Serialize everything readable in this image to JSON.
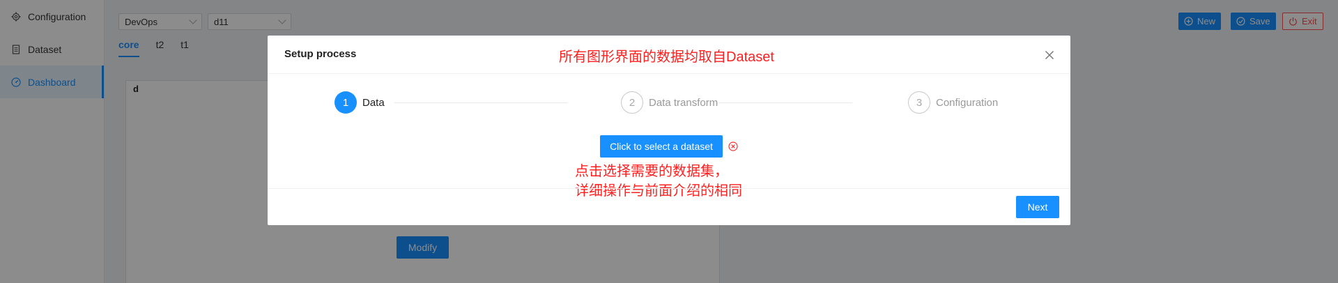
{
  "sidebar": {
    "items": [
      {
        "label": "Configuration",
        "icon": "gear-icon"
      },
      {
        "label": "Dataset",
        "icon": "file-icon"
      },
      {
        "label": "Dashboard",
        "icon": "dashboard-icon",
        "active": true
      }
    ]
  },
  "topbar": {
    "project_select": "DevOps",
    "dashboard_select": "d11",
    "tabs": [
      "core",
      "t2",
      "t1"
    ],
    "active_tab": "core",
    "new_label": "New",
    "save_label": "Save",
    "exit_label": "Exit"
  },
  "panel": {
    "title": "d",
    "modify_label": "Modify"
  },
  "modal": {
    "title": "Setup process",
    "note": "所有图形界面的数据均取自Dataset",
    "steps": [
      {
        "number": "1",
        "label": "Data",
        "status": "active"
      },
      {
        "number": "2",
        "label": "Data transform",
        "status": "wait"
      },
      {
        "number": "3",
        "label": "Configuration",
        "status": "wait"
      }
    ],
    "select_dataset_label": "Click to select a dataset",
    "annotation_line1": "点击选择需要的数据集，",
    "annotation_line2": "详细操作与前面介绍的相同",
    "next_label": "Next"
  },
  "colors": {
    "primary": "#1890ff",
    "danger": "#ff4d4f",
    "annotation": "#ff1f1f"
  }
}
